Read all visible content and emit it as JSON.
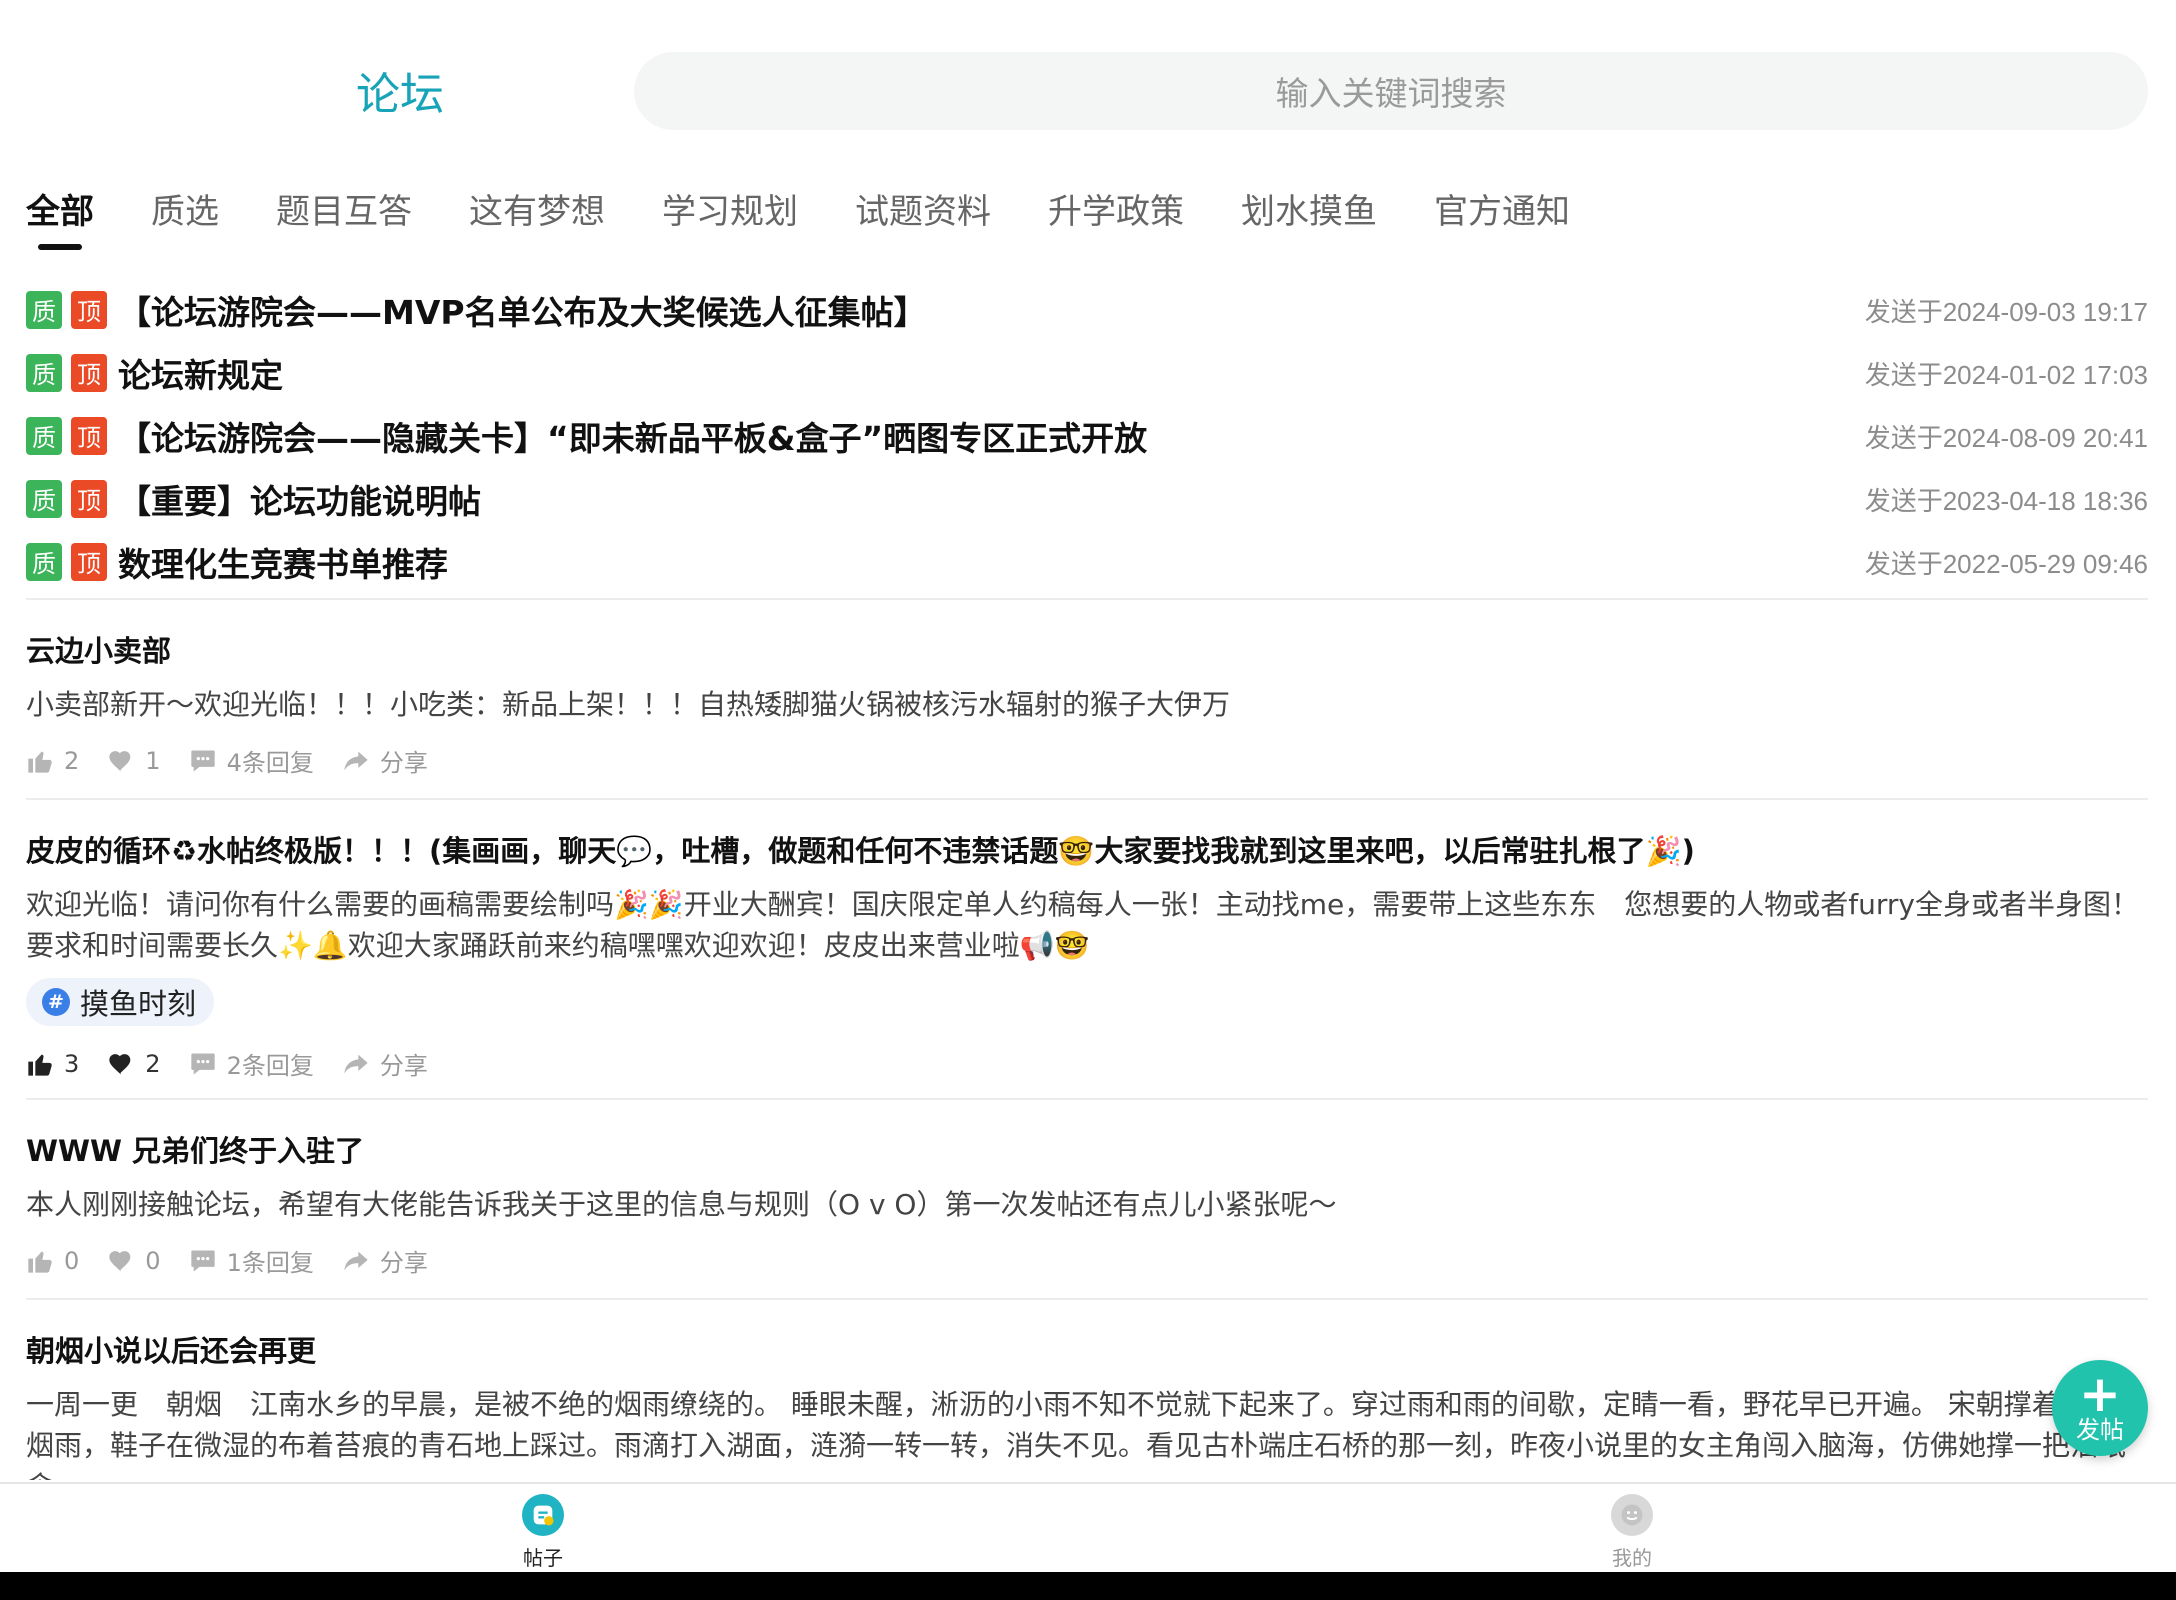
{
  "header": {
    "title": "论坛",
    "search_placeholder": "输入关键词搜索"
  },
  "tabs": [
    "全部",
    "质选",
    "题目互答",
    "这有梦想",
    "学习规划",
    "试题资料",
    "升学政策",
    "划水摸鱼",
    "官方通知"
  ],
  "badges": {
    "quality": "质",
    "top": "顶"
  },
  "pinned": [
    {
      "title": "【论坛游院会——MVP名单公布及大奖候选人征集帖】",
      "time": "发送于2024-09-03 19:17"
    },
    {
      "title": "论坛新规定",
      "time": "发送于2024-01-02 17:03"
    },
    {
      "title": "【论坛游院会——隐藏关卡】“即未新品平板&盒子”晒图专区正式开放",
      "time": "发送于2024-08-09 20:41"
    },
    {
      "title": "【重要】论坛功能说明帖",
      "time": "发送于2023-04-18 18:36"
    },
    {
      "title": "数理化生竞赛书单推荐",
      "time": "发送于2022-05-29 09:46"
    }
  ],
  "posts": [
    {
      "title": "云边小卖部",
      "body": "小卖部新开～欢迎光临！！！小吃类：新品上架！！！自热矮脚猫火锅被核污水辐射的猴子大伊万",
      "likes": "2",
      "favs": "1",
      "replies": "4条回复",
      "share": "分享"
    },
    {
      "title": "皮皮的循环♻水帖终极版！！！(集画画，聊天💬，吐槽，做题和任何不违禁话题🤓大家要找我就到这里来吧，以后常驻扎根了🎉)",
      "body": "欢迎光临！请问你有什么需要的画稿需要绘制吗🎉🎉开业大酬宾！国庆限定单人约稿每人一张！主动找me，需要带上这些东东　您想要的人物或者furry全身或者半身图！要求和时间需要长久✨🔔欢迎大家踊跃前来约稿嘿嘿欢迎欢迎！皮皮出来营业啦📢🤓",
      "tag": "摸鱼时刻",
      "likes": "3",
      "favs": "2",
      "replies": "2条回复",
      "share": "分享"
    },
    {
      "title": "WWW 兄弟们终于入驻了",
      "body": "本人刚刚接触论坛，希望有大佬能告诉我关于这里的信息与规则（O v O）第一次发帖还有点儿小紧张呢～",
      "likes": "0",
      "favs": "0",
      "replies": "1条回复",
      "share": "分享"
    },
    {
      "title": "朝烟小说以后还会再更",
      "body": "一周一更　朝烟　江南水乡的早晨，是被不绝的烟雨缭绕的。 睡眼未醒，淅沥的小雨不知不觉就下起来了。穿过雨和雨的间歇，定睛一看，野花早已开遍。 宋朝撑着伞走过烟雨，鞋子在微湿的布着苔痕的青石地上踩过。雨滴打入湖面，涟漪一转一转，消失不见。看见古朴端庄石桥的那一刻，昨夜小说里的女主角闯入脑海，仿佛她撑一把油纸伞"
    }
  ],
  "fab": {
    "plus": "+",
    "label": "发帖"
  },
  "nav": {
    "posts": "帖子",
    "mine": "我的"
  },
  "colors": {
    "accent": "#17a3b8",
    "quality_badge": "#3cb45a",
    "top_badge": "#ea4a25",
    "fab": "#22c3ad"
  }
}
